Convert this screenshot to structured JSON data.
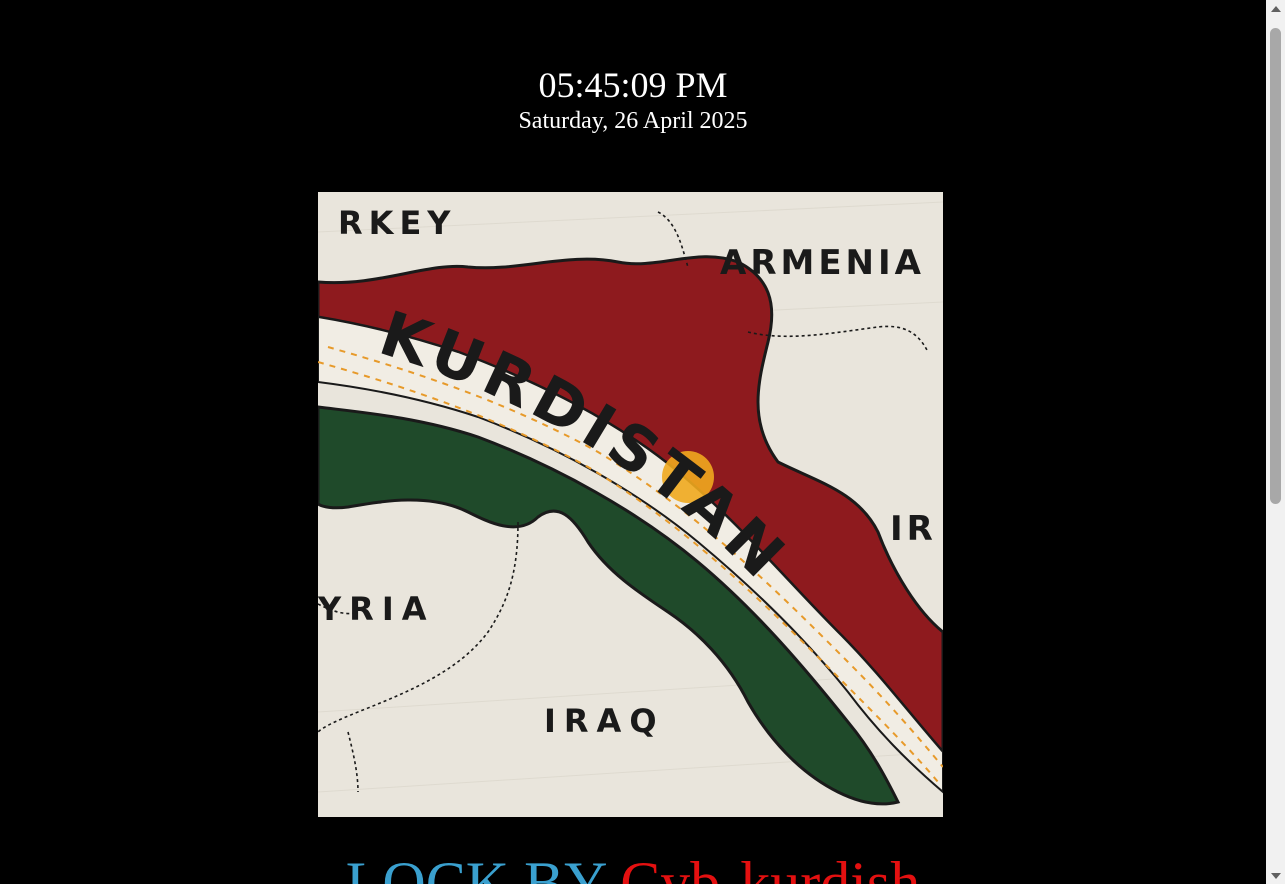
{
  "clock": {
    "time": "05:45:09 PM",
    "date": "Saturday, 26 April 2025"
  },
  "map": {
    "labels": {
      "turkey": "RKEY",
      "armenia": "ARMENIA",
      "kurdistan": "KURDISTAN",
      "iran": "IR",
      "syria": "YRIA",
      "iraq": "IRAQ"
    },
    "colors": {
      "red": "#8e1a1e",
      "white": "#f1ede4",
      "green": "#1f4a2a",
      "sun": "#f0a81e",
      "background": "#e9e5dc"
    }
  },
  "footer": {
    "lock_by": "LOCK BY",
    "author": "Cyb-kurdish"
  },
  "colors": {
    "lock_by": "#3aa0cf",
    "author": "#e41010"
  }
}
